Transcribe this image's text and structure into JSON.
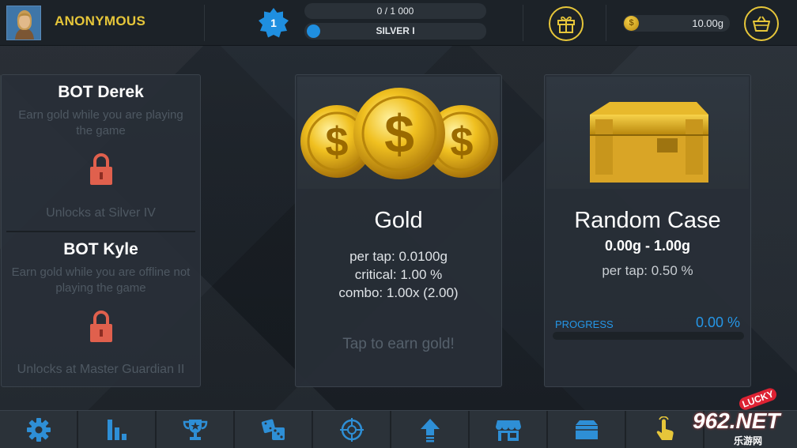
{
  "header": {
    "username": "ANONYMOUS",
    "level": "1",
    "xp_text": "0 / 1 000",
    "rank_text": "SILVER I",
    "gold_balance": "10.00g"
  },
  "bots": [
    {
      "name": "BOT Derek",
      "description": "Earn gold while you are playing the game",
      "unlock_text": "Unlocks at Silver IV"
    },
    {
      "name": "BOT Kyle",
      "description": "Earn gold while you are offline not playing the game",
      "unlock_text": "Unlocks at Master Guardian II"
    }
  ],
  "gold_card": {
    "title": "Gold",
    "stats": [
      "per tap: 0.0100g",
      "critical: 1.00 %",
      "combo: 1.00x (2.00)"
    ],
    "tap_hint": "Tap to earn gold!"
  },
  "case_card": {
    "title": "Random Case",
    "range": "0.00g - 1.00g",
    "per_tap": "per tap: 0.50 %",
    "progress_label": "PROGRESS",
    "progress_value": "0.00 %",
    "progress_fraction": 0
  },
  "bottom_nav": [
    {
      "icon": "gear-icon"
    },
    {
      "icon": "stats-bars-icon"
    },
    {
      "icon": "trophy-icon"
    },
    {
      "icon": "dice-icon"
    },
    {
      "icon": "crosshair-icon"
    },
    {
      "icon": "upgrade-arrow-icon"
    },
    {
      "icon": "shop-icon"
    },
    {
      "icon": "case-box-icon"
    },
    {
      "icon": "tap-hand-icon"
    }
  ],
  "watermark": {
    "brand": "962",
    "suffix": ".NET",
    "badge": "LUCKY",
    "site": "乐游网"
  },
  "colors": {
    "accent_gold": "#e6c63a",
    "accent_blue": "#2596e6",
    "lock_red": "#e0604d"
  }
}
